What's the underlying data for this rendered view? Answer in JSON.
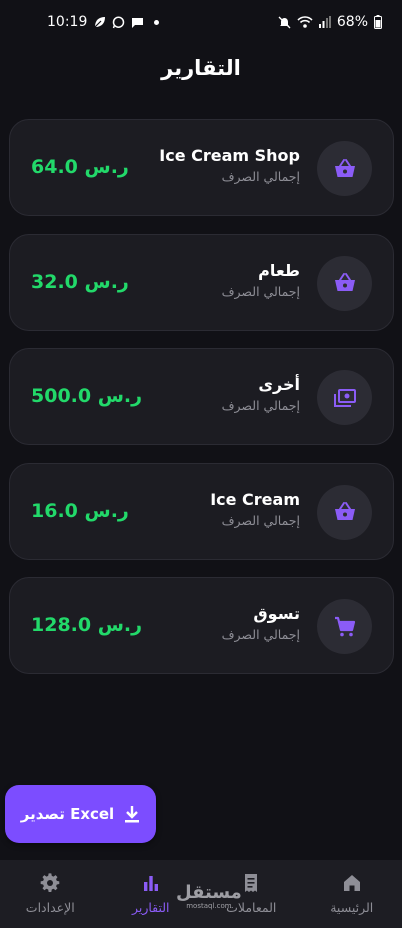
{
  "status_bar": {
    "time": "10:19",
    "battery": "68%"
  },
  "header": {
    "title": "التقارير"
  },
  "colors": {
    "accent": "#7c4dff",
    "amount": "#22d96a",
    "card_bg": "#1c1c22",
    "background": "#111116"
  },
  "reports": [
    {
      "name": "Ice Cream Shop",
      "subtitle": "إجمالي الصرف",
      "amount": "64.0 ر.س",
      "icon": "basket-icon"
    },
    {
      "name": "طعام",
      "subtitle": "إجمالي الصرف",
      "amount": "32.0 ر.س",
      "icon": "basket-icon"
    },
    {
      "name": "أخرى",
      "subtitle": "إجمالي الصرف",
      "amount": "500.0 ر.س",
      "icon": "cash-icon"
    },
    {
      "name": "Ice Cream",
      "subtitle": "إجمالي الصرف",
      "amount": "16.0 ر.س",
      "icon": "basket-icon"
    },
    {
      "name": "تسوق",
      "subtitle": "إجمالي الصرف",
      "amount": "128.0 ر.س",
      "icon": "cart-icon"
    }
  ],
  "export": {
    "label": "تصدير Excel",
    "icon": "download-icon"
  },
  "nav": {
    "items": [
      {
        "label": "الرئيسية",
        "icon": "home-icon",
        "active": false
      },
      {
        "label": "المعاملات",
        "icon": "receipt-icon",
        "active": false
      },
      {
        "label": "التقارير",
        "icon": "bar-chart-icon",
        "active": true
      },
      {
        "label": "الإعدادات",
        "icon": "gear-icon",
        "active": false
      }
    ]
  },
  "watermark": {
    "main": "مستقل",
    "sub": "mostaql.com"
  }
}
